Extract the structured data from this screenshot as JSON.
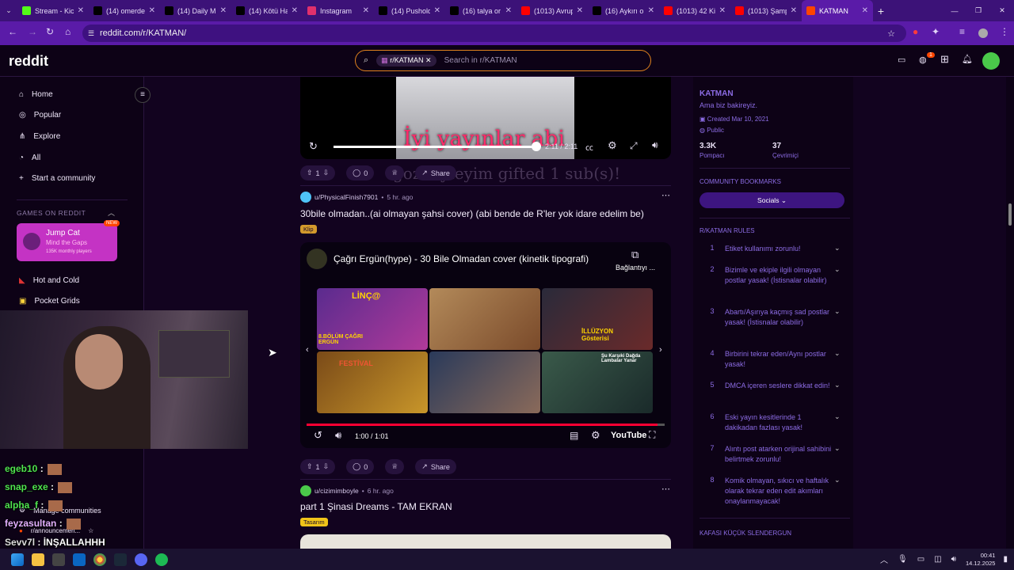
{
  "tabs": [
    {
      "label": "Stream - Kic",
      "icon": "kick-icon",
      "color": "#53fc18"
    },
    {
      "label": "(14) omerde",
      "icon": "x-icon",
      "color": "#000000"
    },
    {
      "label": "(14) Daily M",
      "icon": "x-icon",
      "color": "#000000"
    },
    {
      "label": "(14) Kötü Ha",
      "icon": "x-icon",
      "color": "#000000"
    },
    {
      "label": "Instagram",
      "icon": "instagram-icon",
      "color": "#e1306c"
    },
    {
      "label": "(14) Pushold",
      "icon": "x-icon",
      "color": "#000000"
    },
    {
      "label": "(16) talya or",
      "icon": "x-icon",
      "color": "#000000"
    },
    {
      "label": "(1013) Avrup",
      "icon": "youtube-icon",
      "color": "#ff0000"
    },
    {
      "label": "(16) Aykırı o",
      "icon": "x-icon",
      "color": "#000000"
    },
    {
      "label": "(1013) 42 Ki",
      "icon": "youtube-icon",
      "color": "#ff0000"
    },
    {
      "label": "(1013) Şamp",
      "icon": "youtube-icon",
      "color": "#ff0000"
    },
    {
      "label": "KATMAN",
      "icon": "reddit-icon",
      "color": "#ff4500",
      "active": true
    }
  ],
  "address": {
    "url": "reddit.com/r/KATMAN/"
  },
  "header": {
    "logo": "reddit",
    "search_chip": "r/KATMAN",
    "search_placeholder": "Search in r/KATMAN",
    "notif_count": "1"
  },
  "leftnav": {
    "items": [
      "Home",
      "Popular",
      "Explore",
      "All",
      "Start a community"
    ],
    "games_title": "GAMES ON REDDIT",
    "game_card": {
      "title": "Jump Cat",
      "subtitle": "Mind the Gaps",
      "players": "135K monthly players",
      "badge": "NEW"
    },
    "games": [
      "Hot and Cold",
      "Pocket Grids"
    ],
    "bottom": [
      "Manage communities",
      "r/announcemen..."
    ]
  },
  "video1": {
    "caption": "İyi yayınlar abi",
    "time_cur": "2:11",
    "time_total": "2:11",
    "progress": 1.0,
    "overlay": "gozdeyleyim gifted 1 sub(s)!"
  },
  "post1_actions": {
    "votes": "1",
    "comments": "0",
    "share": "Share"
  },
  "post2": {
    "user": "u/PhysicalFinish7901",
    "age": "5 hr. ago",
    "title": "30bile olmadan..(ai olmayan şahsi cover) (abi bende de R'ler yok idare edelim be)",
    "flair": "Klip",
    "flair_color": "#d39a2c",
    "yt_title": "Çağrı Ergün(hype) - 30 Bile Olmadan cover (kinetik tipografi)",
    "copy_label": "Bağlantıyı ...",
    "thumb_texts": [
      "LİNÇ@",
      "8.BÖLÜM ÇAĞRI ERGÜN",
      "İLLÜZYON Gösterisi",
      "FESTİVAL",
      "Şu Karşıki Dağda Lambalar Yanar"
    ],
    "time": "1:00 / 1:01",
    "progress": 0.98,
    "youtube": "YouTube",
    "votes": "1",
    "comments": "0",
    "share": "Share"
  },
  "post3": {
    "user": "u/cizimimboyle",
    "age": "6 hr. ago",
    "title": "part 1 Şinasi Dreams - TAM EKRAN",
    "flair": "Tasarım",
    "flair_color": "#f0c419"
  },
  "sidebar": {
    "name": "KATMAN",
    "desc": "Ama biz bakireyiz.",
    "created": "Created Mar 10, 2021",
    "visibility": "Public",
    "members": "3.3K",
    "members_label": "Pompacı",
    "online": "37",
    "online_label": "Çevrimiçi",
    "bookmarks_title": "COMMUNITY BOOKMARKS",
    "bookmark_button": "Socials",
    "rules_title": "R/KATMAN RULES",
    "rules": [
      {
        "n": "1",
        "t": "Etiket kullanımı zorunlu!"
      },
      {
        "n": "2",
        "t": "Bizimle ve ekiple ilgili olmayan postlar yasak! (İstisnalar olabilir)"
      },
      {
        "n": "3",
        "t": "Abartı/Aşırıya kaçmış sad postlar yasak! (İstisnalar olabilir)"
      },
      {
        "n": "4",
        "t": "Birbirini tekrar eden/Aynı postlar yasak!"
      },
      {
        "n": "5",
        "t": "DMCA içeren seslere dikkat edin!"
      },
      {
        "n": "6",
        "t": "Eski yayın kesitlerinde 1 dakikadan fazlası yasak!"
      },
      {
        "n": "7",
        "t": "Alıntı post atarken orijinal sahibini belirtmek zorunlu!"
      },
      {
        "n": "8",
        "t": "Komik olmayan, sıkıcı ve haftalık olarak tekrar eden edit akımları onaylanmayacak!"
      }
    ],
    "footer_title": "KAFASI KÜÇÜK SLENDERGUN"
  },
  "chat": [
    {
      "user": "egeb10",
      "msg": "",
      "color": "#4fe34f"
    },
    {
      "user": "snap_exe",
      "msg": "",
      "color": "#4fe34f"
    },
    {
      "user": "alpha_f",
      "msg": "",
      "color": "#4fe34f"
    },
    {
      "user": "feyzasultan",
      "msg": "",
      "color": "#e3b0ff"
    },
    {
      "user": "Sevv7l",
      "msg": "İNŞALLAHHH",
      "color": "#dddddd"
    }
  ],
  "taskbar": {
    "time": "00:41",
    "date": "14.12.2025"
  }
}
